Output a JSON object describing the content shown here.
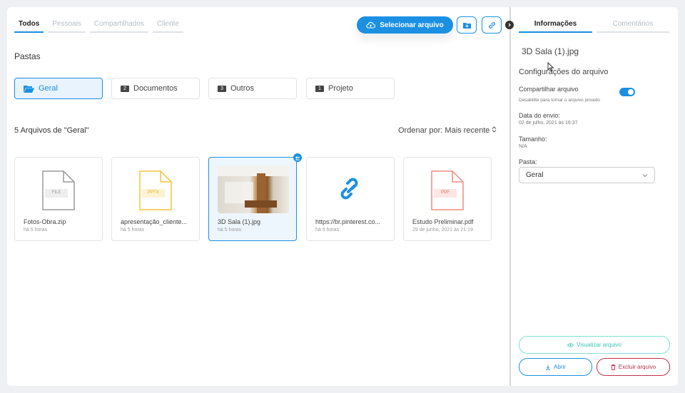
{
  "tabs": [
    "Todos",
    "Pessoais",
    "Compartilhados",
    "Cliente"
  ],
  "actions": {
    "select_file": "Selecionar arquivo"
  },
  "folders_section": {
    "title": "Pastas"
  },
  "folders": [
    {
      "label": "Geral",
      "num": ""
    },
    {
      "label": "Documentos",
      "num": "2"
    },
    {
      "label": "Outros",
      "num": "3"
    },
    {
      "label": "Projeto",
      "num": "1"
    }
  ],
  "files_section": {
    "title": "5 Arquivos de \"Geral\"",
    "sort": "Ordenar por: Mais recente"
  },
  "files": [
    {
      "name": "Fotos-Obra.zip",
      "time": "há 5 horas",
      "ext": "FILE",
      "color": "#9a9a9a"
    },
    {
      "name": "apresentação_cliente...",
      "time": "há 5 horas",
      "ext": "PPTX",
      "color": "#f2c53d"
    },
    {
      "name": "3D Sala (1).jpg",
      "time": "há 5 horas",
      "ext": "",
      "color": ""
    },
    {
      "name": "https://br.pinterest.co...",
      "time": "há 5 horas",
      "ext": "",
      "color": "#1b90e3"
    },
    {
      "name": "Estudo Preliminar.pdf",
      "time": "29 de junho, 2021 às 21:19",
      "ext": "PDF",
      "color": "#f08a80"
    }
  ],
  "right": {
    "tabs": [
      "Informações",
      "Comentários"
    ],
    "file_title": "3D Sala (1).jpg",
    "settings_title": "Configurações do arquivo",
    "share_label": "Compartilhar arquivo",
    "share_hint": "Desabilite para tornar o arquivo privado",
    "share_enabled": true,
    "sent_label": "Data do envio:",
    "sent_value": "02 de julho, 2021 às 16:37",
    "size_label": "Tamanho:",
    "size_value": "N/A",
    "folder_label": "Pasta:",
    "folder_value": "Geral",
    "view_button": "Visualizar arquivo",
    "open_button": "Abrir",
    "delete_button": "Excluir arquivo"
  },
  "colors": {
    "accent": "#1b90e3",
    "teal": "#3cc6b3",
    "danger": "#c0304a"
  }
}
